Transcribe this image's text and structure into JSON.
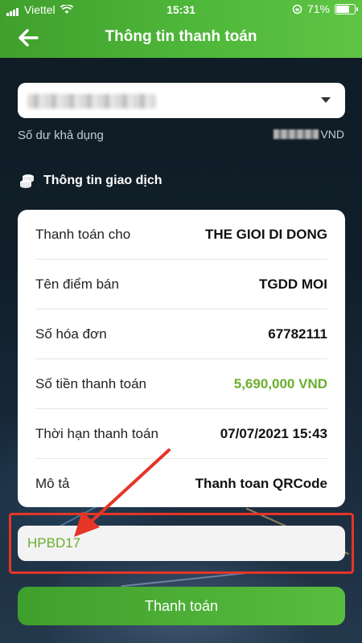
{
  "status_bar": {
    "carrier": "Viettel",
    "time": "15:31",
    "battery": "71%"
  },
  "header": {
    "title": "Thông tin thanh toán",
    "back_icon": "arrow-left-icon"
  },
  "account": {
    "chevron_icon": "chevron-down-icon"
  },
  "balance": {
    "label": "Số dư khả dụng",
    "currency": "VND"
  },
  "section": {
    "title": "Thông tin giao dịch",
    "icon": "coins-icon"
  },
  "details": {
    "rows": [
      {
        "label": "Thanh toán cho",
        "value": "THE GIOI DI DONG"
      },
      {
        "label": "Tên điểm bán",
        "value": "TGDD MOI"
      },
      {
        "label": "Số hóa đơn",
        "value": "67782111"
      },
      {
        "label": "Số tiền thanh toán",
        "value": "5,690,000 VND"
      },
      {
        "label": "Thời hạn thanh toán",
        "value": "07/07/2021 15:43"
      },
      {
        "label": "Mô tả",
        "value": "Thanh toan QRCode"
      }
    ]
  },
  "promo": {
    "value": "HPBD17"
  },
  "pay_button": {
    "label": "Thanh toán"
  },
  "colors": {
    "brand_green": "#4fb83a",
    "amount_green": "#6aaf2e",
    "annotation_red": "#e53527"
  }
}
